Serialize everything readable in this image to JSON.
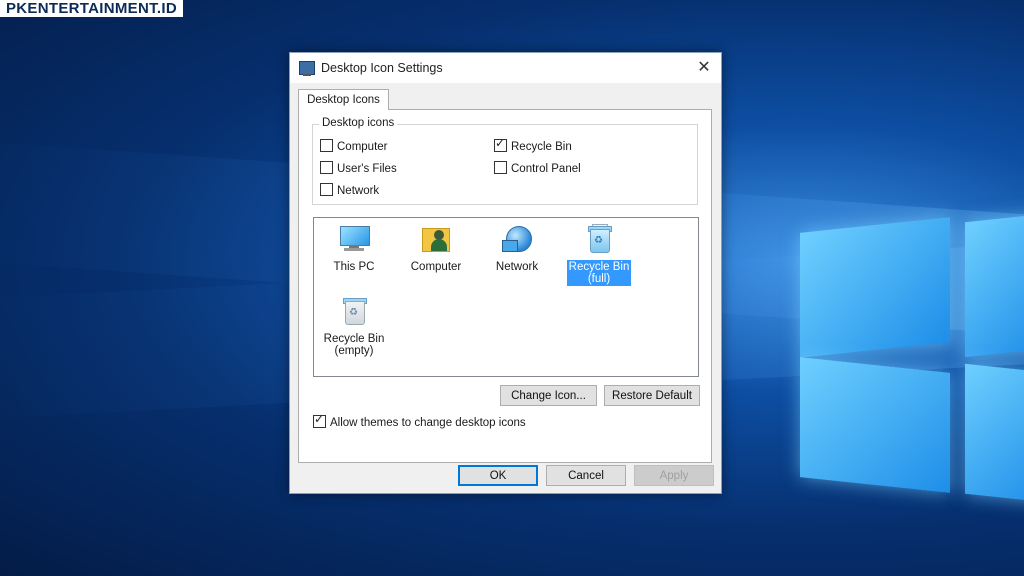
{
  "watermark": "PKENTERTAINMENT.ID",
  "dialog": {
    "title": "Desktop Icon Settings",
    "close_glyph": "✕",
    "tab": "Desktop Icons",
    "group_label": "Desktop icons",
    "checkboxes": [
      {
        "label": "Computer",
        "checked": false
      },
      {
        "label": "Recycle Bin",
        "checked": true
      },
      {
        "label": "User's Files",
        "checked": false
      },
      {
        "label": "Control Panel",
        "checked": false
      },
      {
        "label": "Network",
        "checked": false
      }
    ],
    "icons": [
      {
        "label": "This PC",
        "icon": "this-pc-icon",
        "selected": false
      },
      {
        "label": "Computer",
        "icon": "user-folder-icon",
        "selected": false
      },
      {
        "label": "Network",
        "icon": "network-icon",
        "selected": false
      },
      {
        "label": "Recycle Bin (full)",
        "label_line1": "Recycle Bin",
        "label_line2": "(full)",
        "icon": "recycle-bin-full-icon",
        "selected": true
      },
      {
        "label": "Recycle Bin (empty)",
        "label_line1": "Recycle Bin",
        "label_line2": "(empty)",
        "icon": "recycle-bin-empty-icon",
        "selected": false
      }
    ],
    "change_icon_button": "Change Icon...",
    "restore_default_button": "Restore Default",
    "allow_themes": {
      "label": "Allow themes to change desktop icons",
      "checked": true
    },
    "ok_button": "OK",
    "cancel_button": "Cancel",
    "apply_button": "Apply"
  },
  "colors": {
    "selection": "#3399ff",
    "accent": "#0078d7"
  }
}
